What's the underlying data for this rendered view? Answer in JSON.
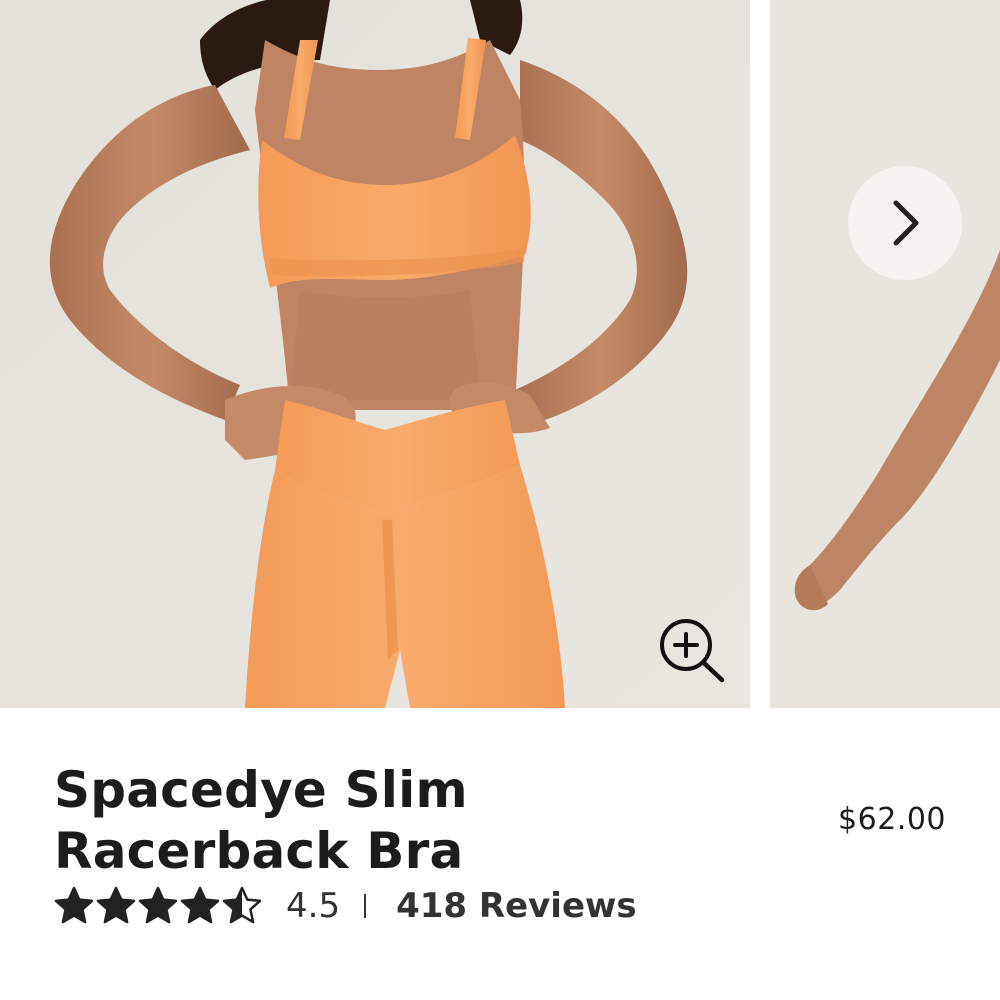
{
  "gallery": {
    "main_image_label": "Model wearing orange Spacedye Slim Racerback Bra with matching leggings",
    "next_image_label": "Model arm, next gallery image",
    "zoom_icon": "zoom-in-icon",
    "next_icon": "chevron-right-icon"
  },
  "product": {
    "title_line1": "Spacedye Slim",
    "title_line2": "Racerback Bra",
    "price": "$62.00",
    "rating": {
      "value": 4.5,
      "value_label": "4.5",
      "max": 5,
      "reviews_label": "418 Reviews",
      "star_color": "#222222"
    }
  },
  "colors": {
    "product_orange": "#f7a25f",
    "text": "#1c1c1c",
    "background": "#e5e1dc"
  }
}
